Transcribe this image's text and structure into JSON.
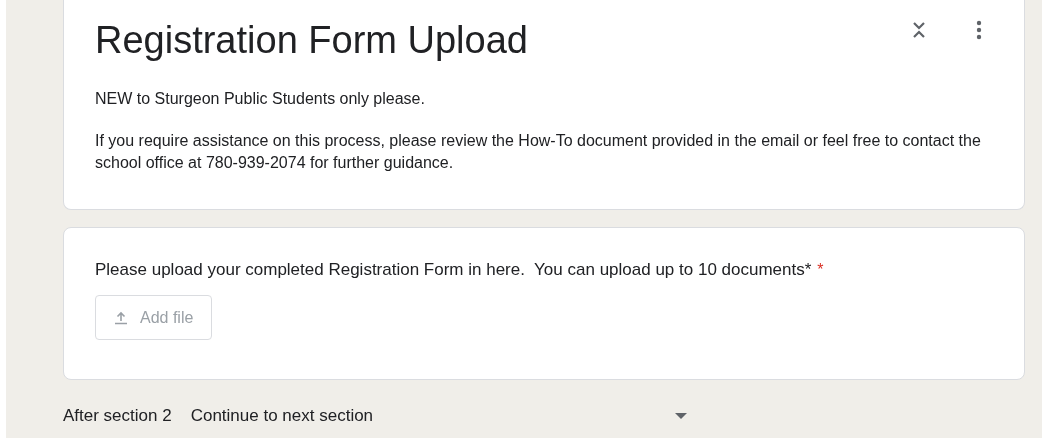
{
  "section_card": {
    "title": "Registration Form Upload",
    "paragraphs": [
      "NEW to Sturgeon Public Students only please.",
      "If you require assistance on this process, please review the How-To document provided in the email or feel free to contact the school office at 780-939-2074 for further guidance."
    ]
  },
  "question": {
    "text": "Please upload your completed Registration Form in here.  You can upload up to 10 documents*",
    "required_mark": "*",
    "button": {
      "label": "Add file",
      "disabled": true
    }
  },
  "after_section": {
    "label": "After section 2",
    "value": "Continue to next section"
  }
}
